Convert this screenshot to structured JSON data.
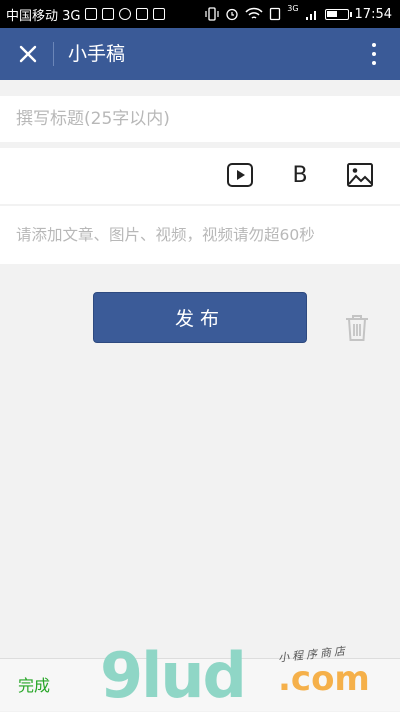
{
  "status_bar": {
    "carrier": "中国移动 3G",
    "time": "17:54",
    "network_badge": "3G"
  },
  "header": {
    "title": "小手稿"
  },
  "editor": {
    "title_placeholder": "撰写标题(25字以内)",
    "content_placeholder": "请添加文章、图片、视频，视频请勿超60秒",
    "bold_label": "B"
  },
  "actions": {
    "publish_label": "发布"
  },
  "bottom_bar": {
    "done_label": "完成"
  },
  "watermark": {
    "brand": "9lud",
    "domain": ".com",
    "tagline": "小程序商店"
  },
  "colors": {
    "header_bg": "#3a5a97",
    "publish_bg": "#3b5b98",
    "done_text": "#27a627"
  },
  "battery_level": 0.55
}
